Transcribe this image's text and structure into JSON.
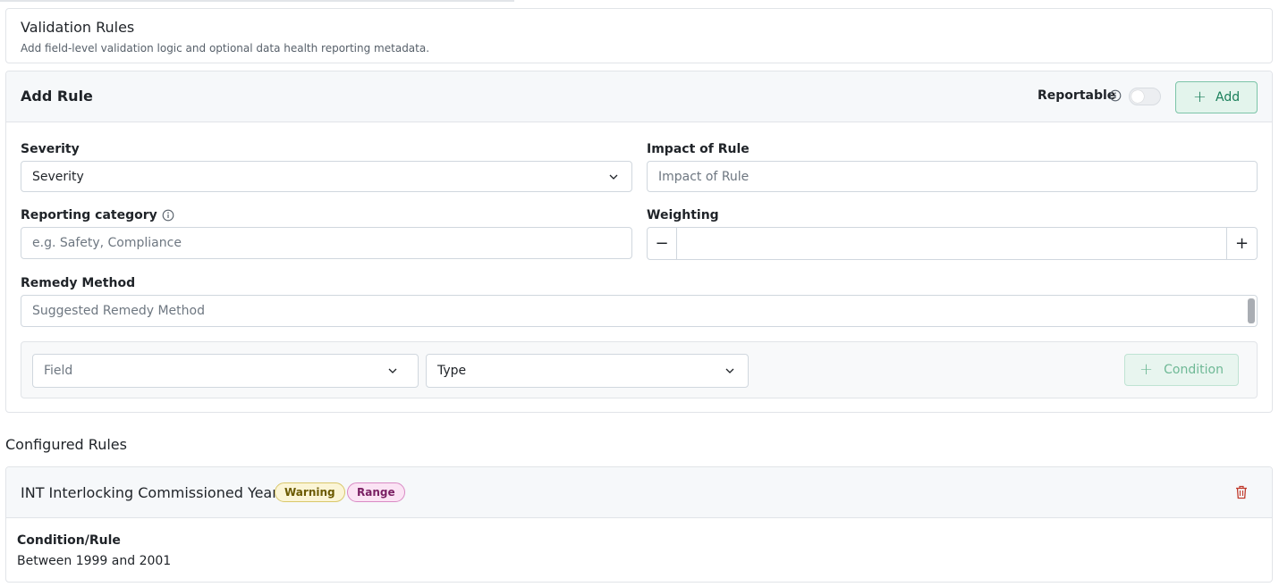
{
  "header": {
    "title": "Validation Rules",
    "subtitle": "Add field-level validation logic and optional data health reporting metadata."
  },
  "add_rule": {
    "title": "Add Rule",
    "reportable_label": "Reportable",
    "reportable_on": false,
    "add_button": "Add",
    "severity": {
      "label": "Severity",
      "value": "Severity"
    },
    "impact": {
      "label": "Impact of Rule",
      "placeholder": "Impact of Rule"
    },
    "reporting_category": {
      "label": "Reporting category",
      "placeholder": "e.g. Safety, Compliance"
    },
    "weighting": {
      "label": "Weighting",
      "value": ""
    },
    "remedy": {
      "label": "Remedy Method",
      "placeholder": "Suggested Remedy Method"
    },
    "condition": {
      "field_placeholder": "Field",
      "type_value": "Type",
      "button": "Condition"
    }
  },
  "configured": {
    "title": "Configured Rules",
    "rules": [
      {
        "name": "INT Interlocking Commissioned Year",
        "severity": "Warning",
        "type": "Range",
        "condition_label": "Condition/Rule",
        "condition_value": "Between 1999 and 2001"
      }
    ]
  },
  "colors": {
    "accent": "#1a7f5a",
    "warning_bg": "#fbf5d6",
    "range_bg": "#fbe3f4",
    "delete": "#c0392b"
  },
  "icons": {
    "info": "info-icon",
    "chevron": "chevron-down-icon",
    "plus": "plus-icon",
    "minus": "minus-icon",
    "trash": "trash-icon"
  }
}
